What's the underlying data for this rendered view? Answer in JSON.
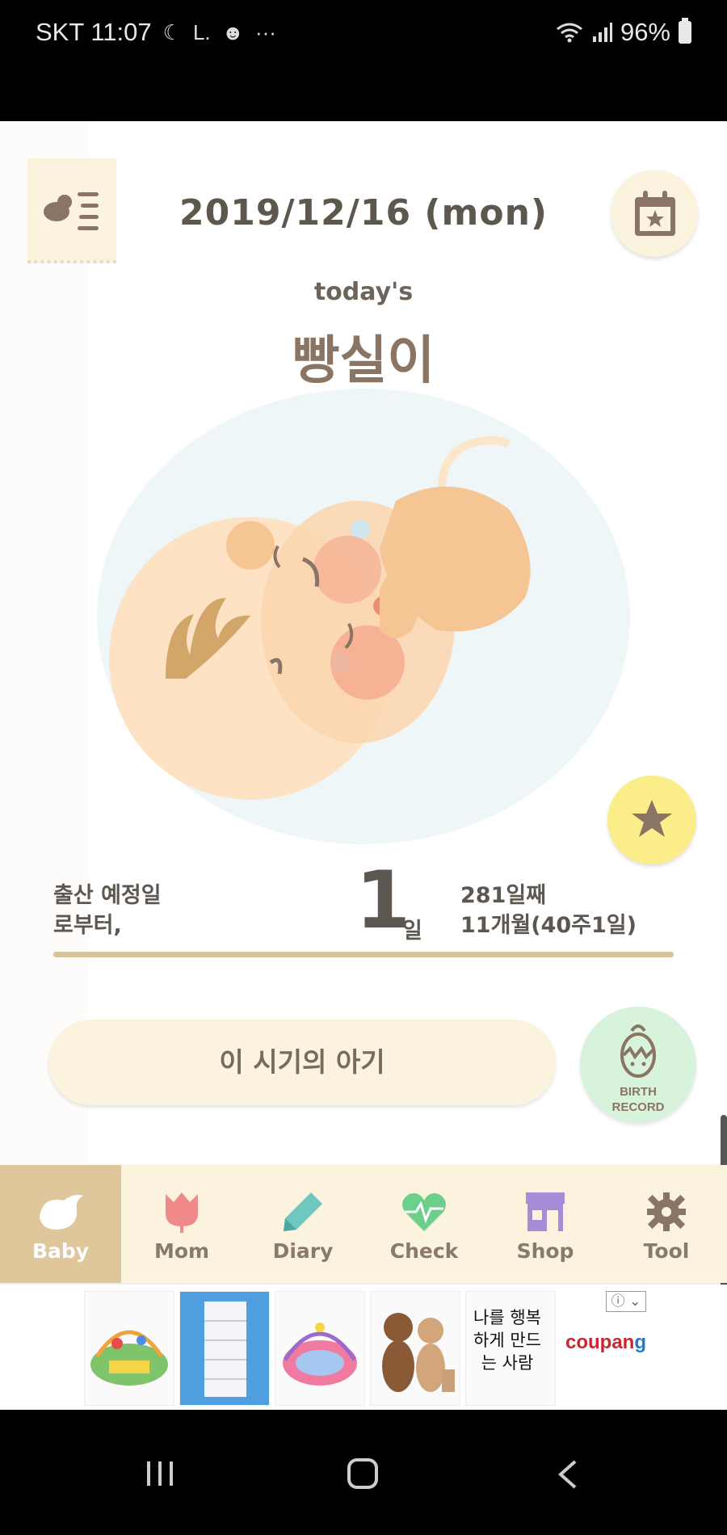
{
  "status_bar": {
    "carrier_time": "SKT 11:07",
    "battery": "96%"
  },
  "header": {
    "date": "2019/12/16 (mon)",
    "todays_label": "today's",
    "baby_name": "빵실이"
  },
  "due": {
    "label_line1": "출산 예정일",
    "label_line2": "로부터,",
    "days_number": "1",
    "days_unit": "일",
    "info_line1": "281일째",
    "info_line2": "11개월(40주1일)"
  },
  "actions": {
    "baby_period_button": "이 시기의 아기",
    "birth_record_line1": "BIRTH",
    "birth_record_line2": "RECORD"
  },
  "bottom_nav": {
    "items": [
      {
        "label": "Baby",
        "icon": "bird-icon",
        "active": true
      },
      {
        "label": "Mom",
        "icon": "tulip-icon",
        "active": false
      },
      {
        "label": "Diary",
        "icon": "pencil-icon",
        "active": false
      },
      {
        "label": "Check",
        "icon": "heartbeat-icon",
        "active": false
      },
      {
        "label": "Shop",
        "icon": "shop-icon",
        "active": false
      },
      {
        "label": "Tool",
        "icon": "gear-icon",
        "active": false
      }
    ]
  },
  "ad": {
    "info_label": "ⓘ ⌄",
    "brand_prefix": "coupan",
    "brand_suffix": "g",
    "handwriting_text": "나를 행복하게 만드는 사람"
  },
  "colors": {
    "accent_cream": "#fcf3de",
    "active_tab": "#dfc79b",
    "text_brown": "#8a7565",
    "birth_record_bg": "#d8f3dc",
    "star_bg": "#fbee8a"
  }
}
